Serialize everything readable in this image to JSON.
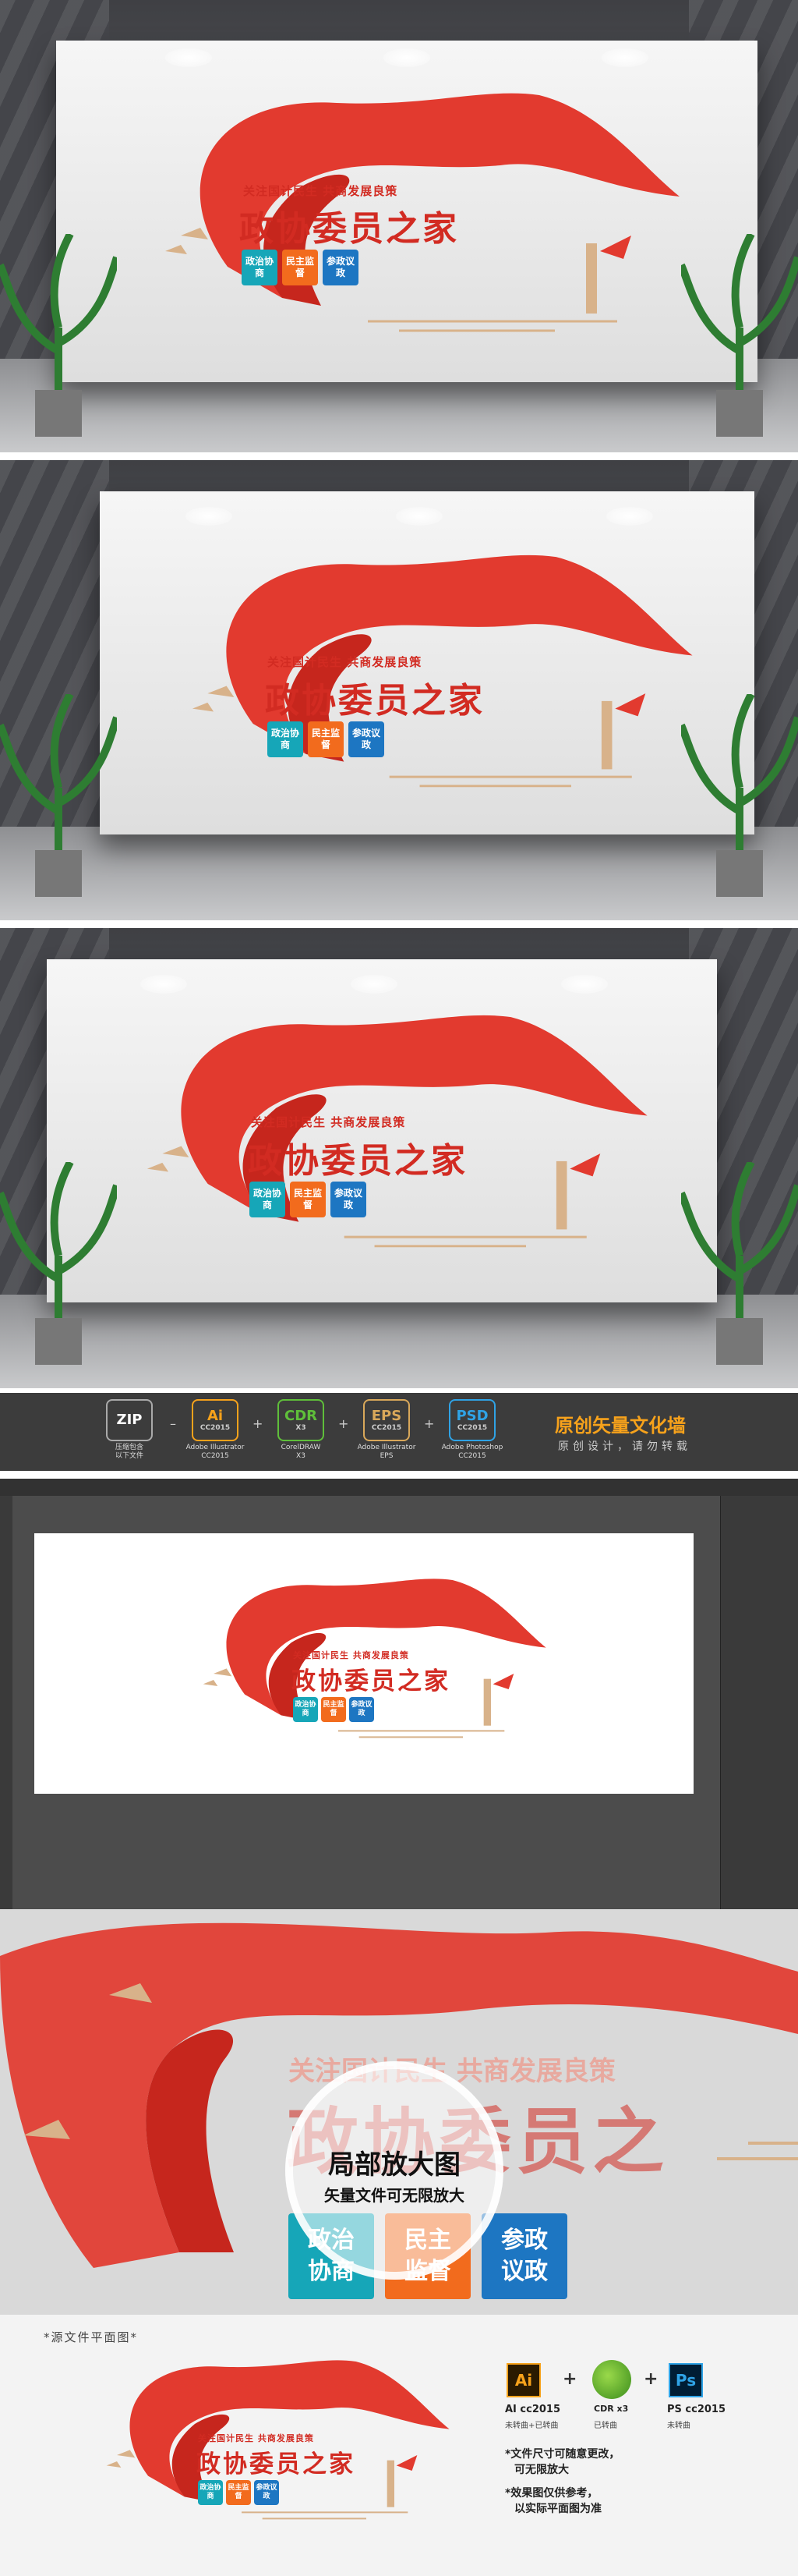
{
  "logo": {
    "slogan": "关注国计民生 共商发展良策",
    "title": "政协委员之家",
    "badges": [
      {
        "text": "政治协商",
        "color": "#16a6b8"
      },
      {
        "text": "民主监督",
        "color": "#f26b1d"
      },
      {
        "text": "参政议政",
        "color": "#1d76c2"
      }
    ],
    "ribbon_color": "#e23a2f"
  },
  "formats": [
    {
      "icon": "zip-icon",
      "big": "ZIP",
      "small": "",
      "caption": "压缩包含\n以下文件"
    },
    {
      "icon": "illustrator-icon",
      "big": "Ai",
      "small": "CC2015",
      "caption": "Adobe Illustrator\nCC2015"
    },
    {
      "icon": "coreldraw-icon",
      "big": "CDR",
      "small": "X3",
      "caption": "CorelDRAW\nX3"
    },
    {
      "icon": "eps-icon",
      "big": "EPS",
      "small": "CC2015",
      "caption": "Adobe Illustrator\nEPS"
    },
    {
      "icon": "photoshop-icon",
      "big": "PSD",
      "small": "CC2015",
      "caption": "Adobe Photoshop\nCC2015"
    }
  ],
  "operators": [
    "–",
    "+",
    "+",
    "+"
  ],
  "format_bar": {
    "heading": "原创矢量文化墙",
    "subheading": "原创设计，请勿转载"
  },
  "zoom": {
    "heading": "局部放大图",
    "subheading": "矢量文件可无限放大",
    "slogan": "关注国计民生 共商发展良策",
    "title": "政协委员之",
    "badges": [
      "政治协商",
      "民主监督",
      "参政议政"
    ]
  },
  "footer": {
    "label": "*源文件平面图*",
    "software": [
      {
        "icon": "illustrator-icon",
        "name": "AI cc2015",
        "note": "未转曲+已转曲"
      },
      {
        "icon": "coreldraw-icon",
        "name": "CDR x3",
        "note": "已转曲"
      },
      {
        "icon": "photoshop-icon",
        "name": "PS cc2015",
        "note": "未转曲"
      }
    ],
    "notes": [
      "*文件尺寸可随意更改，",
      "可无限放大",
      "*效果图仅供参考，",
      "以实际平面图为准"
    ]
  }
}
